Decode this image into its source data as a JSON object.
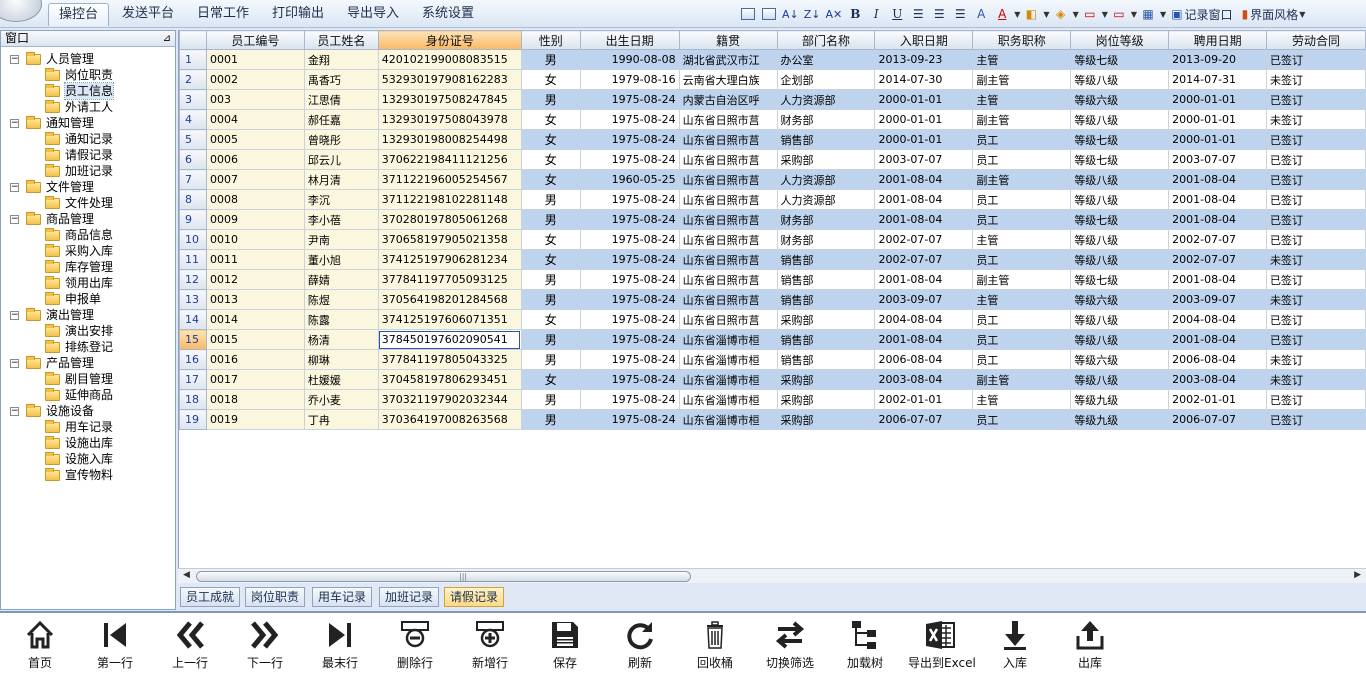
{
  "menu": {
    "tabs": [
      "操控台",
      "发送平台",
      "日常工作",
      "打印输出",
      "导出导入",
      "系统设置"
    ],
    "active_tab": 0,
    "toolbar": {
      "window_label": "记录窗口",
      "style_label": "界面风格"
    }
  },
  "left_panel": {
    "title": "窗口",
    "groups": [
      {
        "label": "人员管理",
        "items": [
          "岗位职责",
          "员工信息",
          "外请工人"
        ]
      },
      {
        "label": "通知管理",
        "items": [
          "通知记录",
          "请假记录",
          "加班记录"
        ]
      },
      {
        "label": "文件管理",
        "items": [
          "文件处理"
        ]
      },
      {
        "label": "商品管理",
        "items": [
          "商品信息",
          "采购入库",
          "库存管理",
          "领用出库",
          "申报单"
        ]
      },
      {
        "label": "演出管理",
        "items": [
          "演出安排",
          "排练登记"
        ]
      },
      {
        "label": "产品管理",
        "items": [
          "剧目管理",
          "延伸商品"
        ]
      },
      {
        "label": "设施设备",
        "items": [
          "用车记录",
          "设施出库",
          "设施入库",
          "宣传物料"
        ]
      }
    ],
    "selected_item": "员工信息"
  },
  "grid": {
    "columns": [
      "员工编号",
      "员工姓名",
      "身份证号",
      "性别",
      "出生日期",
      "籍贯",
      "部门名称",
      "入职日期",
      "职务职称",
      "岗位等级",
      "聘用日期",
      "劳动合同"
    ],
    "highlight_column": 2,
    "current_row": 15,
    "rows": [
      [
        "0001",
        "金翔",
        "420102199008083515",
        "男",
        "1990-08-08",
        "湖北省武汉市江",
        "办公室",
        "2013-09-23",
        "主管",
        "等级七级",
        "2013-09-20",
        "已签订"
      ],
      [
        "0002",
        "禹香巧",
        "532930197908162283",
        "女",
        "1979-08-16",
        "云南省大理白族",
        "企划部",
        "2014-07-30",
        "副主管",
        "等级八级",
        "2014-07-31",
        "未签订"
      ],
      [
        "003",
        "江思倩",
        "132930197508247845",
        "男",
        "1975-08-24",
        "内蒙古自治区呼",
        "人力资源部",
        "2000-01-01",
        "主管",
        "等级六级",
        "2000-01-01",
        "已签订"
      ],
      [
        "0004",
        "郝任嘉",
        "132930197508043978",
        "女",
        "1975-08-24",
        "山东省日照市莒",
        "财务部",
        "2000-01-01",
        "副主管",
        "等级八级",
        "2000-01-01",
        "未签订"
      ],
      [
        "0005",
        "曾晓彤",
        "132930198008254498",
        "女",
        "1975-08-24",
        "山东省日照市莒",
        "销售部",
        "2000-01-01",
        "员工",
        "等级七级",
        "2000-01-01",
        "已签订"
      ],
      [
        "0006",
        "邱云儿",
        "370622198411121256",
        "女",
        "1975-08-24",
        "山东省日照市莒",
        "采购部",
        "2003-07-07",
        "员工",
        "等级七级",
        "2003-07-07",
        "已签订"
      ],
      [
        "0007",
        "林月清",
        "371122196005254567",
        "女",
        "1960-05-25",
        "山东省日照市莒",
        "人力资源部",
        "2001-08-04",
        "副主管",
        "等级八级",
        "2001-08-04",
        "已签订"
      ],
      [
        "0008",
        "李沉",
        "371122198102281148",
        "男",
        "1975-08-24",
        "山东省日照市莒",
        "人力资源部",
        "2001-08-04",
        "员工",
        "等级八级",
        "2001-08-04",
        "已签订"
      ],
      [
        "0009",
        "李小蓓",
        "370280197805061268",
        "男",
        "1975-08-24",
        "山东省日照市莒",
        "财务部",
        "2001-08-04",
        "员工",
        "等级七级",
        "2001-08-04",
        "已签订"
      ],
      [
        "0010",
        "尹南",
        "370658197905021358",
        "女",
        "1975-08-24",
        "山东省日照市莒",
        "财务部",
        "2002-07-07",
        "主管",
        "等级八级",
        "2002-07-07",
        "已签订"
      ],
      [
        "0011",
        "董小旭",
        "374125197906281234",
        "女",
        "1975-08-24",
        "山东省日照市莒",
        "销售部",
        "2002-07-07",
        "员工",
        "等级八级",
        "2002-07-07",
        "未签订"
      ],
      [
        "0012",
        "薛婧",
        "377841197705093125",
        "男",
        "1975-08-24",
        "山东省日照市莒",
        "销售部",
        "2001-08-04",
        "副主管",
        "等级七级",
        "2001-08-04",
        "已签订"
      ],
      [
        "0013",
        "陈煜",
        "370564198201284568",
        "男",
        "1975-08-24",
        "山东省日照市莒",
        "销售部",
        "2003-09-07",
        "主管",
        "等级六级",
        "2003-09-07",
        "未签订"
      ],
      [
        "0014",
        "陈露",
        "374125197606071351",
        "女",
        "1975-08-24",
        "山东省日照市莒",
        "采购部",
        "2004-08-04",
        "员工",
        "等级八级",
        "2004-08-04",
        "已签订"
      ],
      [
        "0015",
        "杨清",
        "378450197602090541",
        "男",
        "1975-08-24",
        "山东省淄博市桓",
        "销售部",
        "2001-08-04",
        "员工",
        "等级八级",
        "2001-08-04",
        "已签订"
      ],
      [
        "0016",
        "柳琳",
        "377841197805043325",
        "男",
        "1975-08-24",
        "山东省淄博市桓",
        "销售部",
        "2006-08-04",
        "员工",
        "等级六级",
        "2006-08-04",
        "未签订"
      ],
      [
        "0017",
        "杜媛媛",
        "370458197806293451",
        "女",
        "1975-08-24",
        "山东省淄博市桓",
        "采购部",
        "2003-08-04",
        "副主管",
        "等级八级",
        "2003-08-04",
        "未签订"
      ],
      [
        "0018",
        "乔小麦",
        "370321197902032344",
        "男",
        "1975-08-24",
        "山东省淄博市桓",
        "采购部",
        "2002-01-01",
        "主管",
        "等级九级",
        "2002-01-01",
        "已签订"
      ],
      [
        "0019",
        "丁冉",
        "370364197008263568",
        "男",
        "1975-08-24",
        "山东省淄博市桓",
        "采购部",
        "2006-07-07",
        "员工",
        "等级九级",
        "2006-07-07",
        "已签订"
      ]
    ]
  },
  "sub_tabs": [
    "员工成就",
    "岗位职责",
    "用车记录",
    "加班记录",
    "请假记录"
  ],
  "active_sub_tab": 4,
  "bottom_toolbar": [
    {
      "icon": "home-icon",
      "label": "首页"
    },
    {
      "icon": "first-icon",
      "label": "第一行"
    },
    {
      "icon": "prev-icon",
      "label": "上一行"
    },
    {
      "icon": "next-icon",
      "label": "下一行"
    },
    {
      "icon": "last-icon",
      "label": "最末行"
    },
    {
      "icon": "delete-row-icon",
      "label": "删除行"
    },
    {
      "icon": "add-row-icon",
      "label": "新增行"
    },
    {
      "icon": "save-icon",
      "label": "保存"
    },
    {
      "icon": "refresh-icon",
      "label": "刷新"
    },
    {
      "icon": "recycle-bin-icon",
      "label": "回收桶"
    },
    {
      "icon": "switch-filter-icon",
      "label": "切换筛选"
    },
    {
      "icon": "load-tree-icon",
      "label": "加载树"
    },
    {
      "icon": "excel-icon",
      "label": "导出到Excel"
    },
    {
      "icon": "import-icon",
      "label": "入库"
    },
    {
      "icon": "export-icon",
      "label": "出库"
    }
  ],
  "colors": {
    "accent": "#f8b964",
    "row_alt": "#bdd3ee",
    "frame": "#7d97bd"
  }
}
